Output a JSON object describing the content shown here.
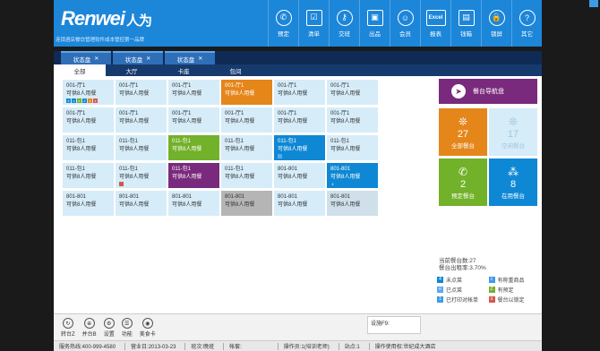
{
  "header": {
    "logo": "Renwei",
    "logo_cn": "人为",
    "tagline": "连锁酒店餐饮管理软件成本管控第一品牌",
    "tools": [
      {
        "label": "预定",
        "icon": "phone-icon",
        "glyph": "✆"
      },
      {
        "label": "清单",
        "icon": "checklist-icon",
        "glyph": "☑"
      },
      {
        "label": "交班",
        "icon": "key-icon",
        "glyph": "⚷"
      },
      {
        "label": "出品",
        "icon": "box-icon",
        "glyph": "▣"
      },
      {
        "label": "会员",
        "icon": "members-icon",
        "glyph": "☺"
      },
      {
        "label": "报表",
        "icon": "excel-icon",
        "glyph": "Excel"
      },
      {
        "label": "钱箱",
        "icon": "cashbox-icon",
        "glyph": "▤"
      },
      {
        "label": "锁屏",
        "icon": "lock-icon",
        "glyph": "🔒"
      },
      {
        "label": "其它",
        "icon": "help-icon",
        "glyph": "?"
      }
    ]
  },
  "tabs": [
    {
      "label": "状态盘",
      "close": "✕"
    },
    {
      "label": "状态盘",
      "close": "✕"
    },
    {
      "label": "状态盘",
      "close": "✕"
    }
  ],
  "subtabs": [
    "全部",
    "大厅",
    "卡座",
    "包间"
  ],
  "tables": [
    {
      "name": "001-厅1",
      "cap": "可供8人用餐",
      "style": "",
      "badges": [
        {
          "t": "4",
          "c": "#0e88d4"
        },
        {
          "t": "c",
          "c": "#0e88d4"
        },
        {
          "t": "e",
          "c": "#72b12a"
        },
        {
          "t": "Z",
          "c": "#0e88d4"
        },
        {
          "t": "1",
          "c": "#e5861b"
        },
        {
          "t": "s",
          "c": "#d9534f"
        }
      ]
    },
    {
      "name": "001-厅1",
      "cap": "可供8人用餐",
      "style": "",
      "badges": []
    },
    {
      "name": "001-厅1",
      "cap": "可供8人用餐",
      "style": "",
      "badges": []
    },
    {
      "name": "001-厅1",
      "cap": "可供8人用餐",
      "style": "orange",
      "badges": []
    },
    {
      "name": "001-厅1",
      "cap": "可供8人用餐",
      "style": "",
      "badges": []
    },
    {
      "name": "001-厅1",
      "cap": "可供8人用餐",
      "style": "",
      "badges": []
    },
    {
      "name": "001-厅1",
      "cap": "可供8人用餐",
      "style": "",
      "badges": []
    },
    {
      "name": "001-厅1",
      "cap": "可供8人用餐",
      "style": "",
      "badges": []
    },
    {
      "name": "001-厅1",
      "cap": "可供8人用餐",
      "style": "",
      "badges": []
    },
    {
      "name": "001-厅1",
      "cap": "可供8人用餐",
      "style": "",
      "badges": []
    },
    {
      "name": "001-厅1",
      "cap": "可供8人用餐",
      "style": "",
      "badges": []
    },
    {
      "name": "001-厅1",
      "cap": "可供8人用餐",
      "style": "",
      "badges": []
    },
    {
      "name": "011-包1",
      "cap": "可供8人用餐",
      "style": "",
      "badges": []
    },
    {
      "name": "011-包1",
      "cap": "可供8人用餐",
      "style": "",
      "badges": []
    },
    {
      "name": "011-包1",
      "cap": "可供8人用餐",
      "style": "green",
      "badges": []
    },
    {
      "name": "011-包1",
      "cap": "可供8人用餐",
      "style": "",
      "badges": []
    },
    {
      "name": "011-包1",
      "cap": "可供8人用餐",
      "style": "blue",
      "badges": [
        {
          "t": "",
          "c": "#5aa8f0"
        }
      ]
    },
    {
      "name": "011-包1",
      "cap": "可供8人用餐",
      "style": "",
      "badges": []
    },
    {
      "name": "011-包1",
      "cap": "可供8人用餐",
      "style": "",
      "badges": []
    },
    {
      "name": "011-包1",
      "cap": "可供8人用餐",
      "style": "",
      "badges": [
        {
          "t": "",
          "c": "#d9534f"
        }
      ]
    },
    {
      "name": "011-包1",
      "cap": "可供8人用餐",
      "style": "purple",
      "badges": []
    },
    {
      "name": "011-包1",
      "cap": "可供8人用餐",
      "style": "",
      "badges": []
    },
    {
      "name": "801-801",
      "cap": "可供8人用餐",
      "style": "",
      "badges": []
    },
    {
      "name": "801-801",
      "cap": "可供8人用餐",
      "style": "blue",
      "badges": [
        {
          "t": "4",
          "c": "#0e88d4"
        }
      ]
    },
    {
      "name": "801-801",
      "cap": "可供8人用餐",
      "style": "",
      "badges": []
    },
    {
      "name": "801-801",
      "cap": "可供8人用餐",
      "style": "",
      "badges": []
    },
    {
      "name": "801-801",
      "cap": "可供8人用餐",
      "style": "",
      "badges": []
    },
    {
      "name": "801-801",
      "cap": "可供8人用餐",
      "style": "gray",
      "badges": []
    },
    {
      "name": "801-801",
      "cap": "可供8人用餐",
      "style": "",
      "badges": []
    },
    {
      "name": "801-801",
      "cap": "可供8人用餐",
      "style": "pale",
      "badges": []
    }
  ],
  "nav": {
    "label": "餐台导航盘",
    "icon": "navigation-icon",
    "glyph": "➤"
  },
  "stats": {
    "total": {
      "num": "27",
      "label": "全部餐台",
      "glyph": "❊"
    },
    "free": {
      "num": "17",
      "label": "空闲餐台",
      "glyph": "❊"
    },
    "booked": {
      "num": "2",
      "label": "预定餐台",
      "glyph": "✆"
    },
    "used": {
      "num": "8",
      "label": "在用餐台",
      "glyph": "⁂"
    }
  },
  "info": {
    "count": "当前餐台数:27",
    "rate": "餐台出租率:3.70%"
  },
  "legend": [
    {
      "label": "未点菜",
      "color": "#0e88d4",
      "glyph": "4"
    },
    {
      "label": "有称重商品",
      "color": "#3d9be6",
      "glyph": "c"
    },
    {
      "label": "已点菜",
      "color": "#5aa8f0",
      "glyph": "e"
    },
    {
      "label": "有预定",
      "color": "#72b12a",
      "glyph": "Z"
    },
    {
      "label": "已打印对帐单",
      "color": "#3d9be6",
      "glyph": "1"
    },
    {
      "label": "餐台以锁定",
      "color": "#d9534f",
      "glyph": "s"
    }
  ],
  "bottom_tools": [
    {
      "label": "转台Z",
      "glyph": "↻",
      "icon": "transfer-icon"
    },
    {
      "label": "并台B",
      "glyph": "⊕",
      "icon": "merge-icon"
    },
    {
      "label": "设置",
      "glyph": "⚙",
      "icon": "settings-icon"
    },
    {
      "label": "功能",
      "glyph": "☰",
      "icon": "function-icon"
    },
    {
      "label": "美食卡",
      "glyph": "◉",
      "icon": "foodcard-icon"
    }
  ],
  "setting_box": "设施F9:",
  "status": {
    "hotline": "服务热线:400-999-4580",
    "business_day": "营业日:2013-03-23",
    "shift": "班次:晚班",
    "account": "帐套:",
    "operator": "操作员:1(培训老师)",
    "station": "站点:1",
    "license": "操作使用权:世纪成大酒店"
  }
}
